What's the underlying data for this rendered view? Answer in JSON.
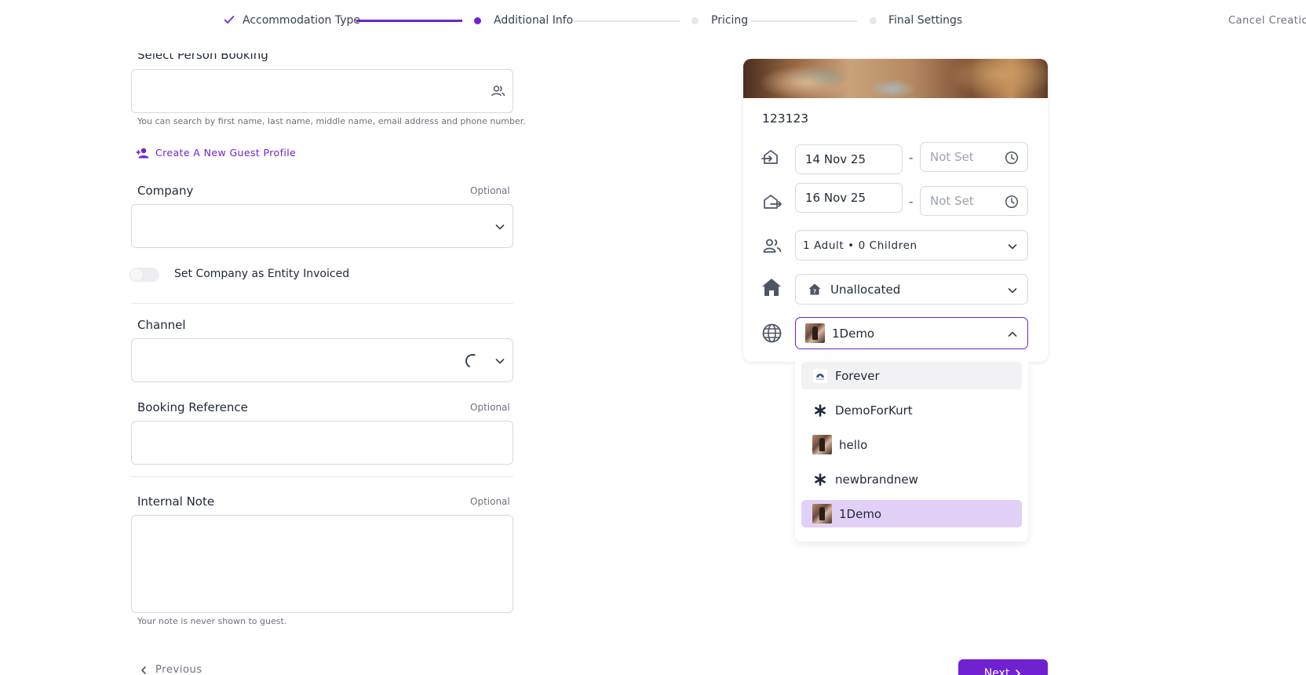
{
  "stepper": {
    "steps": [
      {
        "label": "Accommodation Type",
        "state": "done"
      },
      {
        "label": "Additional Info",
        "state": "active"
      },
      {
        "label": "Pricing",
        "state": "pending"
      },
      {
        "label": "Final Settings",
        "state": "pending"
      }
    ],
    "cancel_label": "Cancel Creation",
    "accent_color": "#7022d3"
  },
  "form": {
    "person_booking": {
      "label": "Select Person Booking",
      "value": "",
      "help": "You can search by first name, last name, middle name, email address and phone number."
    },
    "create_guest_label": "Create A New Guest Profile",
    "company": {
      "label": "Company",
      "optional": "Optional",
      "value": ""
    },
    "entity_invoiced": {
      "label": "Set Company as Entity Invoiced",
      "on": false
    },
    "channel": {
      "label": "Channel",
      "value": "",
      "loading": true
    },
    "booking_reference": {
      "label": "Booking Reference",
      "optional": "Optional",
      "value": ""
    },
    "internal_note": {
      "label": "Internal Note",
      "optional": "Optional",
      "value": "",
      "help": "Your note is never shown to guest."
    },
    "previous_label": "Previous",
    "next_label": "Next"
  },
  "card": {
    "property_name": "123123",
    "check_in": {
      "date": "14 Nov 25",
      "time": "Not Set"
    },
    "check_out": {
      "date": "16 Nov 25",
      "time": "Not Set"
    },
    "guests": "1 Adult • 0 Children",
    "room": "Unallocated",
    "channel_selected": "1Demo"
  },
  "dropdown": {
    "options": [
      {
        "label": "Forever",
        "icon": "forever-logo-icon",
        "state": "hover"
      },
      {
        "label": "DemoForKurt",
        "icon": "asterisk-icon",
        "state": ""
      },
      {
        "label": "hello",
        "icon": "photo-thumb-icon",
        "state": ""
      },
      {
        "label": "newbrandnew",
        "icon": "asterisk-icon",
        "state": ""
      },
      {
        "label": "1Demo",
        "icon": "photo-thumb-icon",
        "state": "selected"
      }
    ]
  }
}
